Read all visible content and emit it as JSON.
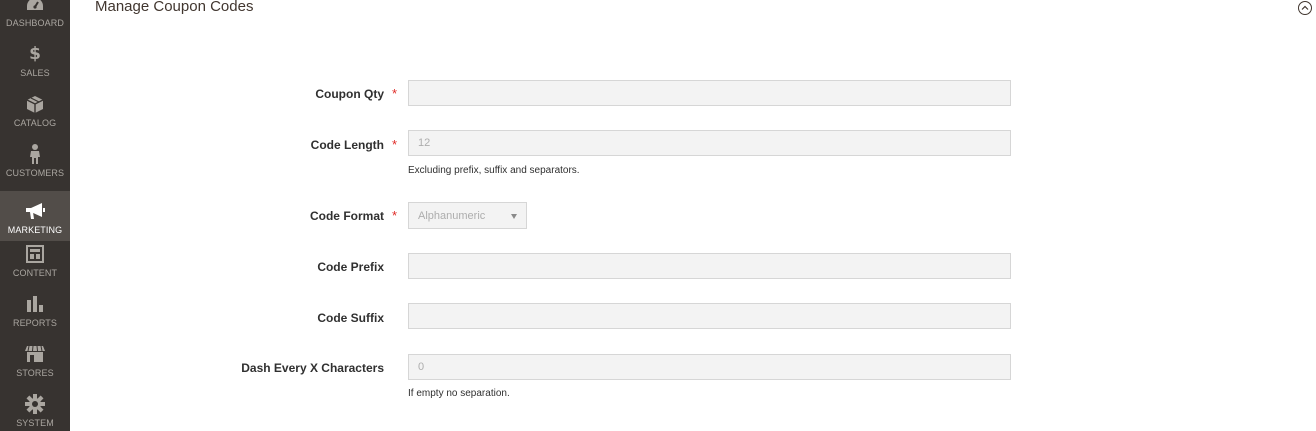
{
  "sidebar": {
    "items": [
      {
        "label": "DASHBOARD",
        "icon": "dashboard-icon"
      },
      {
        "label": "SALES",
        "icon": "dollar-icon",
        "glyph": "$"
      },
      {
        "label": "CATALOG",
        "icon": "box-icon"
      },
      {
        "label": "CUSTOMERS",
        "icon": "person-icon"
      },
      {
        "label": "MARKETING",
        "icon": "megaphone-icon",
        "active": true
      },
      {
        "label": "CONTENT",
        "icon": "layout-icon"
      },
      {
        "label": "REPORTS",
        "icon": "bar-chart-icon"
      },
      {
        "label": "STORES",
        "icon": "storefront-icon"
      },
      {
        "label": "SYSTEM",
        "icon": "gear-icon"
      }
    ]
  },
  "section": {
    "title": "Manage Coupon Codes",
    "collapse_icon": "chevron-up-circle-icon"
  },
  "form": {
    "coupon_qty": {
      "label": "Coupon Qty",
      "value": "",
      "required": "*"
    },
    "code_length": {
      "label": "Code Length",
      "value": "12",
      "required": "*",
      "note": "Excluding prefix, suffix and separators."
    },
    "code_format": {
      "label": "Code Format",
      "value": "Alphanumeric",
      "required": "*"
    },
    "code_prefix": {
      "label": "Code Prefix",
      "value": ""
    },
    "code_suffix": {
      "label": "Code Suffix",
      "value": ""
    },
    "dash_every": {
      "label": "Dash Every X Characters",
      "value": "0",
      "note": "If empty no separation."
    }
  },
  "colors": {
    "sidebar_bg": "#373330",
    "sidebar_active_bg": "#524d49",
    "required_star": "#e02b27",
    "input_bg": "#f3f3f3"
  }
}
